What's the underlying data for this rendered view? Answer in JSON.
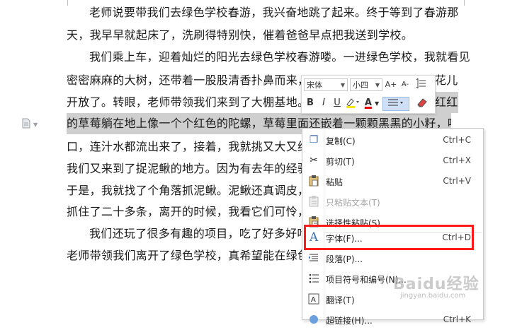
{
  "document": {
    "lines": [
      "老师说要带我们去绿色学校春游，我兴奋地跳了起来。终于等到了春游那",
      "天，我早早就起床了，洗刷得特别快，催着爸爸早点把我送到学校。",
      "我们乘上车，迎着灿烂的阳光去绿色学校春游喽。一进绿色学校，我就看见",
      "密密麻麻的大树，还带着一股股清香扑鼻而来，",
      "开放了。转眼，老师带领我们来到了大棚基地。",
      "的草莓躺在地上像一个个红色的陀螺，草莓里面还嵌着一颗颗黑黑的小籽，咬一",
      "口，连汁水都流出来了，接着，我就挑又大又红的",
      "我们又来到了捉泥鳅的地方。因为有去年的经验",
      "于是，我就找了个角落抓泥鳅。泥鳅还真调皮，",
      "抓住了二十多条，离开的时候，我看它们可怜，",
      "我们还玩了很多有趣的项目，吃了好多好吃",
      "老师带领我们离开了绿色学校，真希望能在绿色"
    ],
    "line3_tail": "花儿",
    "line4_tail": "红红"
  },
  "mini_toolbar": {
    "font_name": "宋体",
    "font_size": "小四",
    "grow_label": "A+",
    "shrink_label": "A-",
    "bold": "B",
    "italic": "I",
    "underline": "U",
    "font_color": "A"
  },
  "context_menu": {
    "items": [
      {
        "label": "复制(C)",
        "shortcut": "Ctrl+C",
        "icon": "copy-icon",
        "glyph": "❐",
        "disabled": false
      },
      {
        "label": "剪切(T)",
        "shortcut": "Ctrl+X",
        "icon": "scissors-icon",
        "glyph": "✂",
        "disabled": false
      },
      {
        "label": "粘贴",
        "shortcut": "Ctrl+V",
        "icon": "paste-icon",
        "glyph": "📋",
        "disabled": false
      },
      {
        "label": "只粘贴文本(T)",
        "shortcut": "",
        "icon": "paste-text-icon",
        "glyph": "📋",
        "disabled": true
      },
      {
        "label": "选择性粘贴(S)...",
        "shortcut": "",
        "icon": "paste-special-icon",
        "glyph": "📋",
        "disabled": false
      },
      {
        "label": "字体(F)...",
        "shortcut": "Ctrl+D",
        "icon": "font-icon",
        "glyph": "A",
        "disabled": false
      },
      {
        "label": "段落(P)...",
        "shortcut": "",
        "icon": "paragraph-icon",
        "glyph": "≡",
        "disabled": false
      },
      {
        "label": "项目符号和编号(N)...",
        "shortcut": "",
        "icon": "bullets-icon",
        "glyph": "☰",
        "disabled": false
      },
      {
        "label": "翻译(T)",
        "shortcut": "",
        "icon": "translate-icon",
        "glyph": "A",
        "disabled": false
      },
      {
        "label": "超链接(H)...",
        "shortcut": "Ctrl+K",
        "icon": "hyperlink-icon",
        "glyph": "🔗",
        "disabled": false
      }
    ]
  },
  "watermark": {
    "brand": "Baidu经验",
    "url": "jingyan.baidu.com"
  },
  "colors": {
    "highlight": "#cfcfcf",
    "red_box": "#ff1a1a",
    "icon_blue": "#3b6fb6"
  }
}
